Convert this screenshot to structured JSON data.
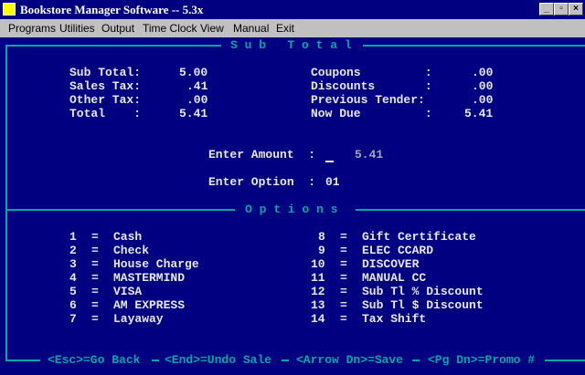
{
  "window": {
    "title": "Bookstore Manager Software -- 5.3x"
  },
  "menu": [
    "Programs",
    "Utilities",
    "Output",
    "Time Clock",
    "View",
    "Manual",
    "Exit"
  ],
  "subtotal_header": "S u b   T o t a l",
  "totals_left": [
    {
      "label": "Sub Total:",
      "value": "5.00"
    },
    {
      "label": "Sales Tax:",
      "value": ".41"
    },
    {
      "label": "Other Tax:",
      "value": ".00"
    },
    {
      "label": "Total    :",
      "value": "5.41"
    }
  ],
  "totals_right": [
    {
      "label": "Coupons         :",
      "value": ".00"
    },
    {
      "label": "Discounts       :",
      "value": ".00"
    },
    {
      "label": "Previous Tender:",
      "value": ".00"
    },
    {
      "label": "Now Due         :",
      "value": "5.41"
    }
  ],
  "entry": {
    "amount_label": "Enter Amount  :",
    "amount_value": "5.41",
    "option_label": "Enter Option  :",
    "option_value": "01"
  },
  "options_header": "O p t i o n s",
  "options_left": [
    {
      "num": "1",
      "label": "Cash"
    },
    {
      "num": "2",
      "label": "Check"
    },
    {
      "num": "3",
      "label": "House Charge"
    },
    {
      "num": "4",
      "label": "MASTERMIND"
    },
    {
      "num": "5",
      "label": "VISA"
    },
    {
      "num": "6",
      "label": "AM EXPRESS"
    },
    {
      "num": "7",
      "label": "Layaway"
    }
  ],
  "options_right": [
    {
      "num": "8",
      "label": "Gift Certificate"
    },
    {
      "num": "9",
      "label": "ELEC CCARD"
    },
    {
      "num": "10",
      "label": "DISCOVER"
    },
    {
      "num": "11",
      "label": "MANUAL CC"
    },
    {
      "num": "12",
      "label": "Sub Tl % Discount"
    },
    {
      "num": "13",
      "label": "Sub Tl $ Discount"
    },
    {
      "num": "14",
      "label": "Tax Shift"
    }
  ],
  "footer": {
    "esc": "<Esc>=Go Back",
    "end": "<End>=Undo Sale",
    "arrow": "<Arrow Dn>=Save",
    "pgdn": "<Pg Dn>=Promo #"
  }
}
